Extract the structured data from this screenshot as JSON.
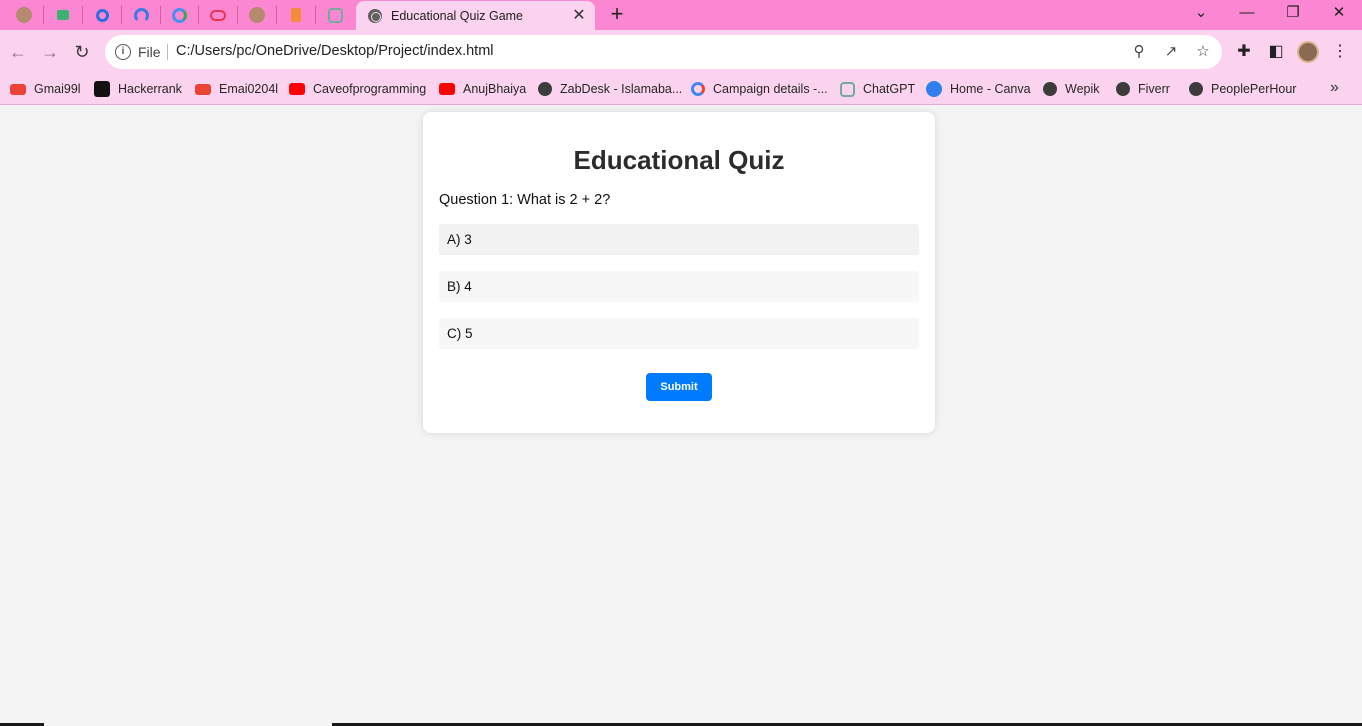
{
  "browser": {
    "mini_tabs": [
      {
        "icon": "avatar-icon",
        "color": "#b58a6e"
      },
      {
        "icon": "bar-chart-icon",
        "color": "#3bb273"
      },
      {
        "icon": "g-circle-icon",
        "color": "#2d6cdf"
      },
      {
        "icon": "rainbow-icon",
        "color": "#3d79e3"
      },
      {
        "icon": "g-swirl-icon",
        "color": "#4a8ef0"
      },
      {
        "icon": "oval-icon",
        "color": "#e8364e"
      },
      {
        "icon": "avatar-icon",
        "color": "#b58a6e"
      },
      {
        "icon": "stack-icon",
        "color": "#f38a3c"
      },
      {
        "icon": "chatgpt-icon",
        "color": "#74aa9c"
      }
    ],
    "active_tab": {
      "title": "Educational Quiz Game",
      "close": "✕"
    },
    "new_tab": "+",
    "window_controls": {
      "tab_search": "⌄",
      "minimize": "—",
      "restore": "❐",
      "close": "✕"
    },
    "address_bar": {
      "scheme_label": "File",
      "url": "C:/Users/pc/OneDrive/Desktop/Project/index.html"
    },
    "bookmarks": [
      {
        "label": "Gmai99l",
        "icon": "gmail-icon",
        "color": "#ea4335"
      },
      {
        "label": "Hackerrank",
        "icon": "hackerrank-icon",
        "color": "#111111"
      },
      {
        "label": "Emai0204l",
        "icon": "gmail-icon",
        "color": "#ea4335"
      },
      {
        "label": "Caveofprogramming",
        "icon": "youtube-icon",
        "color": "#ff0000"
      },
      {
        "label": "AnujBhaiya",
        "icon": "youtube-icon",
        "color": "#ff0000"
      },
      {
        "label": "ZabDesk - Islamaba...",
        "icon": "globe-icon",
        "color": "#3c3c3c"
      },
      {
        "label": "Campaign details -...",
        "icon": "google-icon",
        "color": "#4285f4"
      },
      {
        "label": "ChatGPT",
        "icon": "chatgpt-icon",
        "color": "#74aa9c"
      },
      {
        "label": "Home - Canva",
        "icon": "canva-icon",
        "color": "#2f80ed"
      },
      {
        "label": "Wepik",
        "icon": "globe-icon",
        "color": "#3c3c3c"
      },
      {
        "label": "Fiverr",
        "icon": "globe-icon",
        "color": "#3c3c3c"
      },
      {
        "label": "PeoplePerHour",
        "icon": "globe-icon",
        "color": "#3c3c3c"
      }
    ],
    "bookmarks_more": "»"
  },
  "quiz": {
    "title": "Educational Quiz",
    "question": "Question 1: What is 2 + 2?",
    "options": [
      "A) 3",
      "B) 4",
      "C) 5"
    ],
    "submit_label": "Submit",
    "accent_color": "#007bff"
  }
}
